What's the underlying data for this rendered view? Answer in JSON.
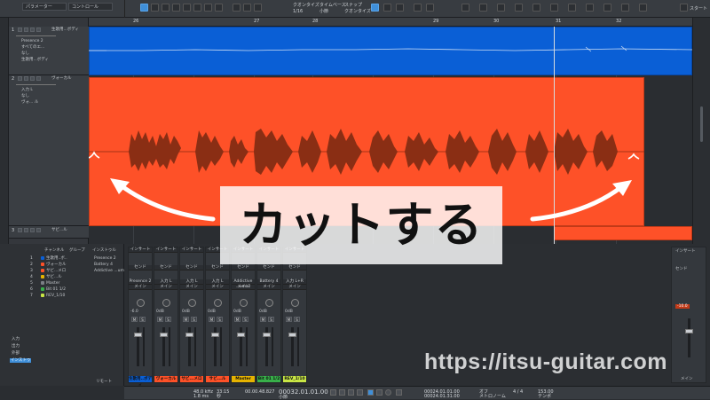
{
  "top": {
    "tab_parameters": "パラメーター",
    "tab_control": "コントロール",
    "quantize_label": "クオンタイズ",
    "quantize_value": "1/16",
    "timebase_label": "タイムベース",
    "timebase_value": "小節",
    "snap_label": "スナップ",
    "snap_value": "クオンタイズ",
    "start_label": "スタート"
  },
  "ruler": [
    "26",
    "27",
    "28",
    "29",
    "30",
    "31",
    "32"
  ],
  "tracks": [
    {
      "num": "1",
      "name": "生歌用...ボディ",
      "sub_rows": [
        "Presence 2",
        "すべてのエ...",
        "なし",
        "生歌用...ボディ"
      ],
      "color": "#0a5fd6"
    },
    {
      "num": "2",
      "name": "ヴォーカル",
      "sub_rows": [
        "入力 L",
        "なし",
        "ヴォ... ル"
      ],
      "color": "#fe5128"
    },
    {
      "num": "3",
      "name": "サビ...ル"
    }
  ],
  "channels_panel": {
    "header_channel": "チャンネル",
    "header_group": "グループ",
    "rows": [
      {
        "num": "1",
        "name": "生歌用..ボ..",
        "color": "#0a5fd6"
      },
      {
        "num": "2",
        "name": "ヴォーカル",
        "color": "#fe5128"
      },
      {
        "num": "3",
        "name": "サビ...メロ",
        "color": "#fe5128"
      },
      {
        "num": "4",
        "name": "サビ...ル",
        "color": "#e6b300"
      },
      {
        "num": "5",
        "name": "Master",
        "color": "#7b7f86"
      },
      {
        "num": "6",
        "name": "Bit 01 1/2",
        "color": "#38b04a"
      },
      {
        "num": "7",
        "name": "REV_1/10",
        "color": "#c9e645"
      }
    ],
    "instruments_header": "インストゥル",
    "instruments": [
      "Presence 2",
      "Battery 4",
      "Addictive ...ums2"
    ],
    "side_labels": [
      "入力",
      "出力",
      "外部",
      "インストゥ"
    ],
    "footer": "リモート"
  },
  "mixer": {
    "strips": [
      {
        "label": "Presence 2",
        "sub": "メイン",
        "name": "生歌用..ボディ",
        "color": "#0a5fd6",
        "value": "-6.0"
      },
      {
        "label": "入力 L",
        "sub": "メイン",
        "name": "ヴォーカル",
        "color": "#fe5128",
        "value": "0dB"
      },
      {
        "label": "入力 L",
        "sub": "メイン",
        "name": "サビ...メロ",
        "color": "#fe5128",
        "value": "0dB"
      },
      {
        "label": "入力 L",
        "sub": "メイン",
        "name": "サビ...ル",
        "color": "#fe5128",
        "value": "0dB"
      },
      {
        "label": "Addictive ...ums2",
        "sub": "メイン",
        "name": "Master",
        "color": "#e6b300",
        "value": "0dB"
      },
      {
        "label": "Battery 4",
        "sub": "メイン",
        "name": "Bit 01 1/2",
        "color": "#38b04a",
        "value": "0dB"
      },
      {
        "label": "入力 L+R",
        "sub": "メイン",
        "name": "REV_1/10",
        "color": "#c9e645",
        "value": "0dB"
      }
    ],
    "inserts_label": "インサート",
    "sends_label": "センド",
    "master_label": "メイン",
    "master_value": "-10.0"
  },
  "transport": {
    "sample_rate": "48.0 kHz",
    "latency": "1.8 ms",
    "time_sec": "33:15",
    "time_label": "秒",
    "position_small": "00.00.48.827",
    "position_main": "00032.01.01.00",
    "bars_label": "小節",
    "loop_start": "00024.01.01.00",
    "loop_end": "00024.01.31.00",
    "signature": "4 / 4",
    "tempo": "153.00",
    "tempo_label": "テンポ",
    "sync_label": "オフ",
    "metronome_label": "メトロノーム"
  },
  "caption": "カットする",
  "watermark": "https://itsu-guitar.com"
}
